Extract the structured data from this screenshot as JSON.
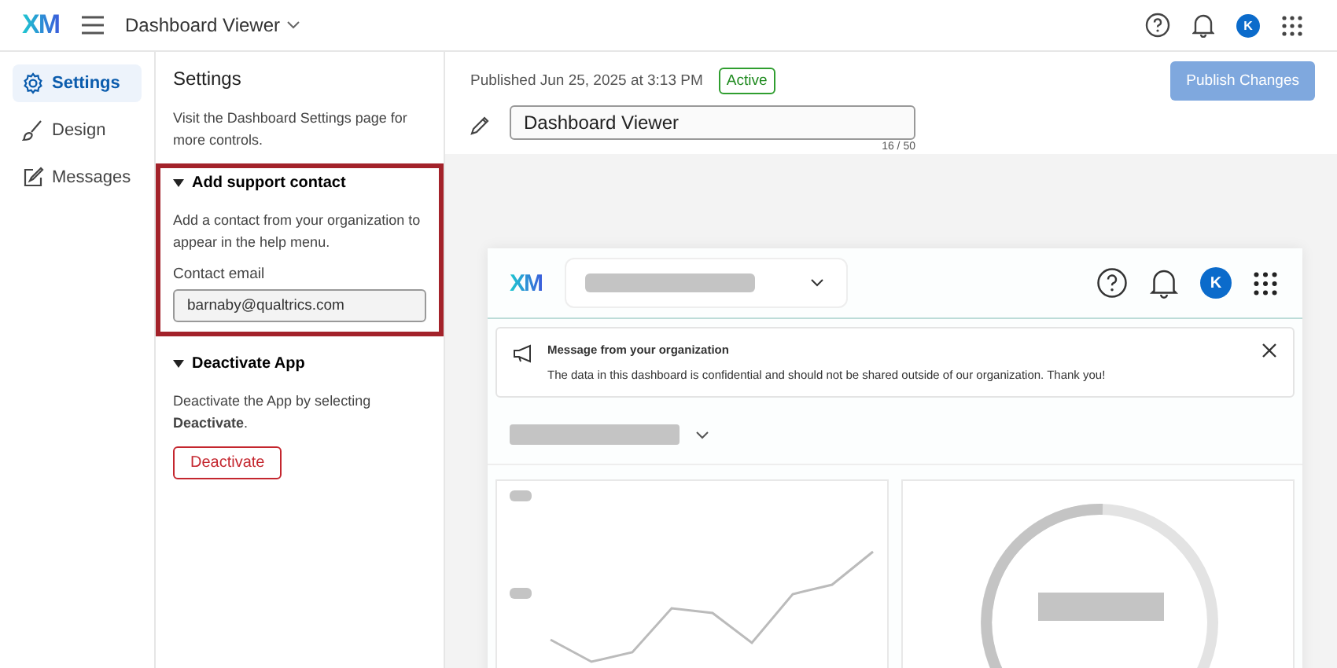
{
  "topbar": {
    "logo": "XM",
    "title": "Dashboard Viewer",
    "avatar": "K"
  },
  "nav": [
    {
      "label": "Settings",
      "selected": true
    },
    {
      "label": "Design",
      "selected": false
    },
    {
      "label": "Messages",
      "selected": false
    }
  ],
  "settings": {
    "title": "Settings",
    "intro": "Visit the Dashboard Settings page for more controls.",
    "sections": [
      {
        "kind": "contact",
        "title": "Add support contact",
        "expanded": true,
        "highlighted": true,
        "text": "Add a contact from your organization to appear in the help menu.",
        "field_label": "Contact email",
        "value": "barnaby@qualtrics.com"
      },
      {
        "kind": "deactivate",
        "title": "Deactivate App",
        "expanded": true,
        "highlighted": false,
        "text": "Deactivate the App by selecting **Deactivate**.",
        "button": "Deactivate"
      }
    ]
  },
  "header": {
    "published": "Published Jun 25, 2025 at 3:13 PM",
    "status": "Active",
    "publish_button": "Publish Changes",
    "publish_disabled": true,
    "name_value": "Dashboard Viewer",
    "counter": "16 / 50"
  },
  "preview": {
    "logo": "XM",
    "avatar": "K",
    "message": {
      "title": "Message from your organization",
      "text": "The data in this dashboard is confidential and should not be shared outside of our organization. Thank you!"
    }
  }
}
